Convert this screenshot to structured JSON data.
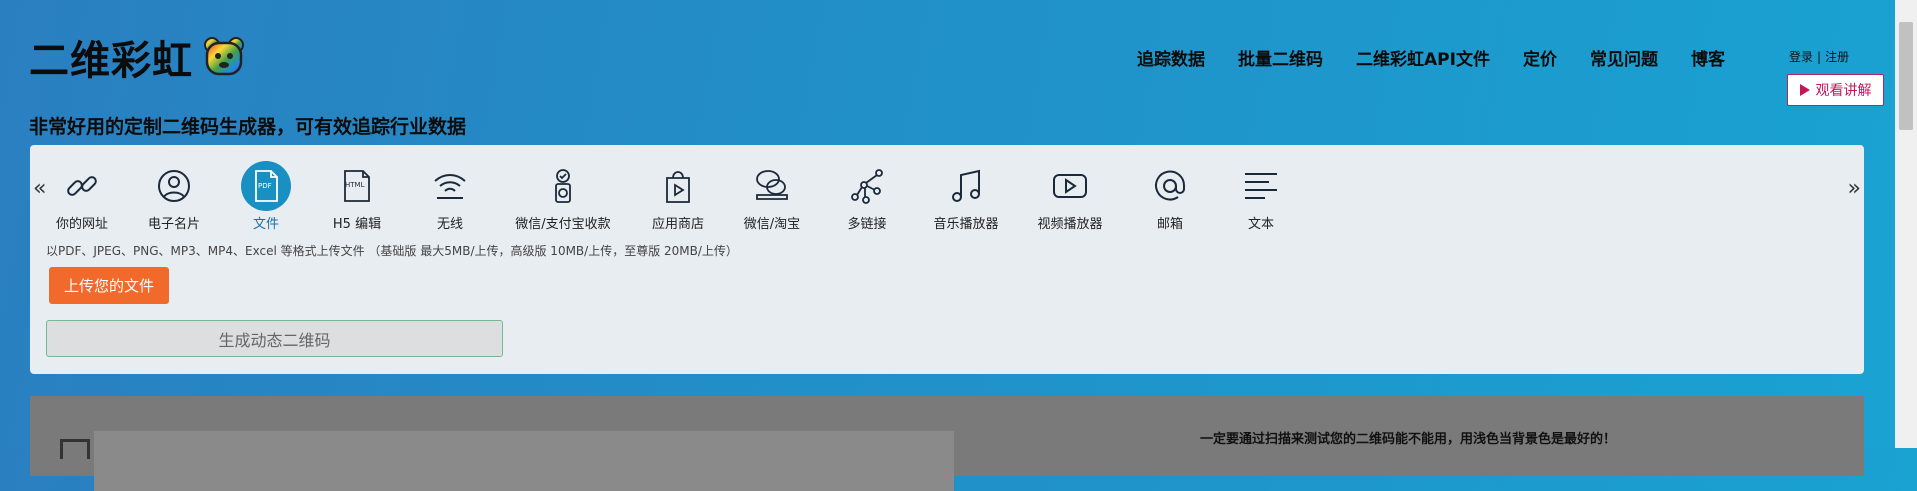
{
  "brand": {
    "name": "二维彩虹"
  },
  "tagline": "非常好用的定制二维码生成器，可有效追踪行业数据",
  "nav": [
    {
      "label": "追踪数据"
    },
    {
      "label": "批量二维码"
    },
    {
      "label": "二维彩虹API文件"
    },
    {
      "label": "定价"
    },
    {
      "label": "常见问题"
    },
    {
      "label": "博客"
    }
  ],
  "auth": {
    "login": "登录",
    "sep": "|",
    "register": "注册"
  },
  "watch_button": "观看讲解",
  "types": [
    {
      "label": "你的网址",
      "icon": "link-icon"
    },
    {
      "label": "电子名片",
      "icon": "user-icon"
    },
    {
      "label": "文件",
      "icon": "pdf-file-icon",
      "active": true
    },
    {
      "label": "H5 编辑",
      "icon": "html-file-icon"
    },
    {
      "label": "无线",
      "icon": "wifi-icon"
    },
    {
      "label": "微信/支付宝收款",
      "icon": "payment-icon"
    },
    {
      "label": "应用商店",
      "icon": "app-store-icon"
    },
    {
      "label": "微信/淘宝",
      "icon": "wechat-icon"
    },
    {
      "label": "多链接",
      "icon": "multi-link-icon"
    },
    {
      "label": "音乐播放器",
      "icon": "music-icon"
    },
    {
      "label": "视频播放器",
      "icon": "video-icon"
    },
    {
      "label": "邮箱",
      "icon": "email-icon"
    },
    {
      "label": "文本",
      "icon": "text-icon"
    }
  ],
  "upload_hint": "以PDF、JPEG、PNG、MP3、MP4、Excel 等格式上传文件 （基础版 最大5MB/上传，高级版 10MB/上传，至尊版 20MB/上传）",
  "upload_button": "上传您的文件",
  "generate_button": "生成动态二维码",
  "lower_note": "一定要通过扫描来测试您的二维码能不能用，用浅色当背景色是最好的！",
  "colors": {
    "accent": "#1a8fc2",
    "upload": "#f26a2b",
    "watch": "#c2185b"
  }
}
